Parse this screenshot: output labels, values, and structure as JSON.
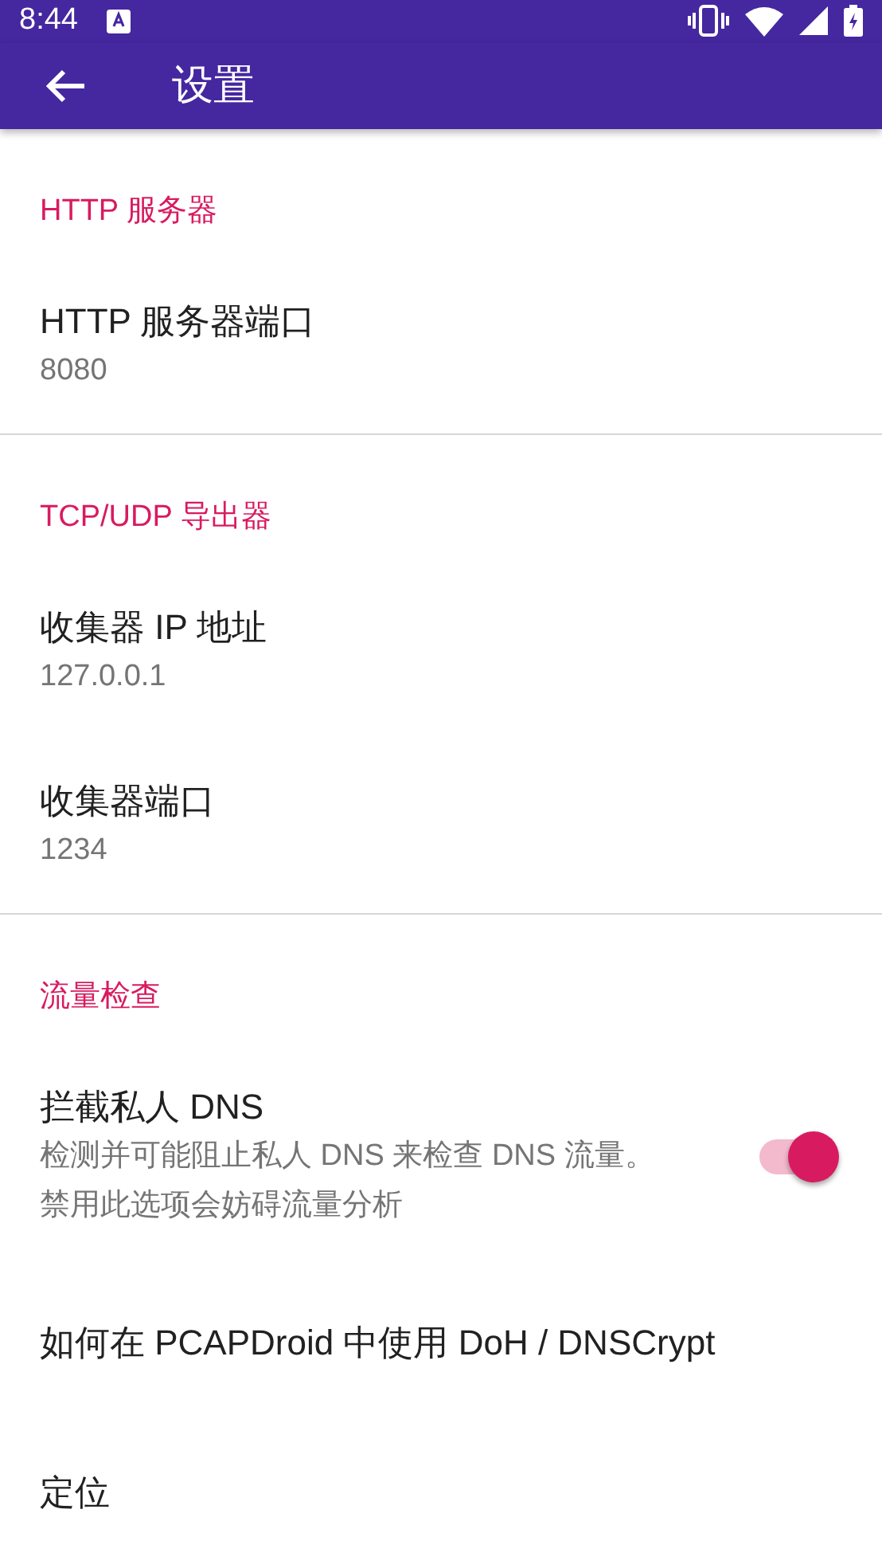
{
  "status_bar": {
    "time": "8:44"
  },
  "app_bar": {
    "title": "设置"
  },
  "sections": [
    {
      "title": "HTTP 服务器",
      "items": [
        {
          "kind": "text",
          "title": "HTTP 服务器端口",
          "summary": "8080"
        }
      ]
    },
    {
      "title": "TCP/UDP 导出器",
      "items": [
        {
          "kind": "text",
          "title": "收集器 IP 地址",
          "summary": "127.0.0.1"
        },
        {
          "kind": "text",
          "title": "收集器端口",
          "summary": "1234"
        }
      ]
    },
    {
      "title": "流量检查",
      "items": [
        {
          "kind": "switch",
          "title": "拦截私人 DNS",
          "summary": "检测并可能阻止私人 DNS 来检查 DNS 流量。禁用此选项会妨碍流量分析",
          "on": true
        },
        {
          "kind": "text",
          "title": "如何在 PCAPDroid 中使用 DoH / DNSCrypt"
        },
        {
          "kind": "text",
          "title": "定位"
        }
      ]
    }
  ]
}
